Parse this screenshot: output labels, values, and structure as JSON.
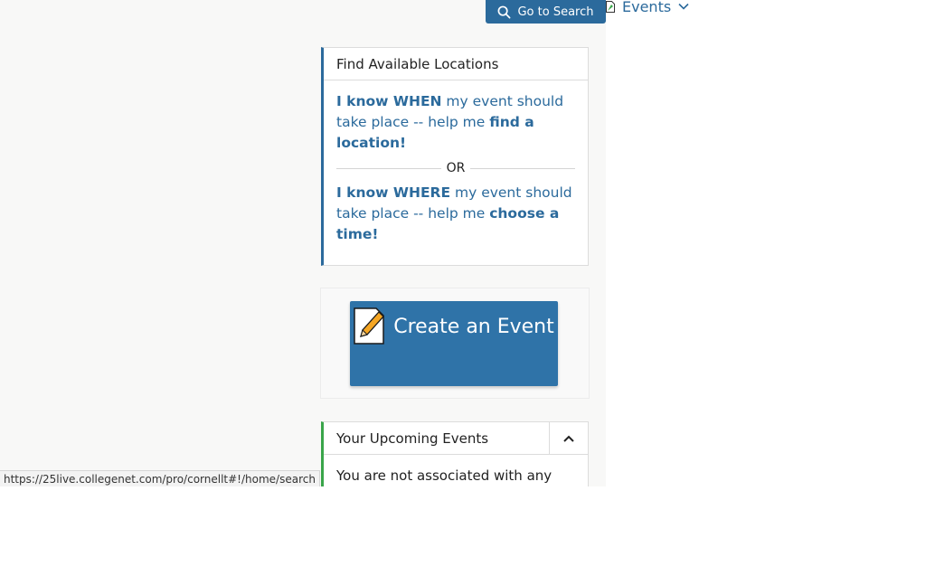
{
  "header": {
    "go_search_label": "Go to Search",
    "events_label": "Events"
  },
  "find_locations": {
    "title": "Find Available Locations",
    "when_link": {
      "bold1": "I know WHEN",
      "text1": " my event should take place -- help me ",
      "bold2": "find a location!"
    },
    "or_label": "OR",
    "where_link": {
      "bold1": "I know WHERE",
      "text1": " my event should take place -- help me ",
      "bold2": "choose a time!"
    }
  },
  "create_event": {
    "label": "Create an Event"
  },
  "upcoming": {
    "title": "Your Upcoming Events",
    "empty_text": "You are not associated with any"
  },
  "status_bar": {
    "url": "https://25live.collegenet.com/pro/cornellt#!/home/search"
  },
  "colors": {
    "brand_blue": "#2b6a9c",
    "accent_green": "#3aa54a",
    "icon_orange": "#f5a623"
  },
  "icons": {
    "search": "search-icon",
    "events": "document-icon",
    "chevron": "chevron-down-icon",
    "pad": "notepad-pencil-icon",
    "collapse": "chevron-up-icon"
  }
}
